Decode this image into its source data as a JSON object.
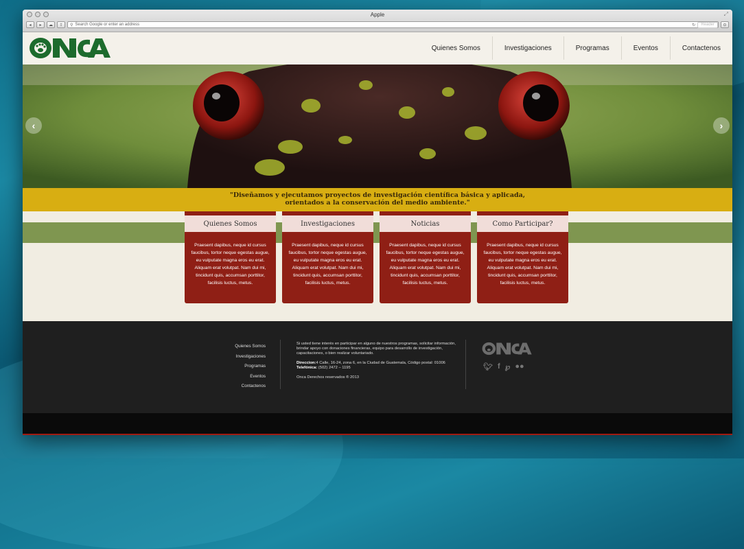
{
  "browser": {
    "title": "Apple",
    "address_placeholder": "Search Google or enter an address",
    "reader_label": "Reader"
  },
  "site": {
    "logo_text": "ONCA",
    "nav": [
      "Quienes Somos",
      "Investigaciones",
      "Programas",
      "Eventos",
      "Contactenos"
    ],
    "quote_line1": "\"Diseñamos y ejecutamos proyectos de investigación científica básica y aplicada,",
    "quote_line2": "orientados a la conservación del medio ambiente.\"",
    "cards": [
      {
        "title": "Quienes Somos",
        "text": "Praesent dapibus, neque id cursus faucibus, tortor neque egestas augue, eu vulputate magna eros eu erat. Aliquam erat volutpat. Nam dui mi, tincidunt quis, accumsan porttitor, facilisis luctus, metus."
      },
      {
        "title": "Investigaciones",
        "text": "Praesent dapibus, neque id cursus faucibus, tortor neque egestas augue, eu vulputate magna eros eu erat. Aliquam erat volutpat. Nam dui mi, tincidunt quis, accumsan porttitor, facilisis luctus, metus."
      },
      {
        "title": "Noticias",
        "text": "Praesent dapibus, neque id cursus faucibus, tortor neque egestas augue, eu vulputate magna eros eu erat. Aliquam erat volutpat. Nam dui mi, tincidunt quis, accumsan porttitor, facilisis luctus, metus."
      },
      {
        "title": "Como Participar?",
        "text": "Praesent dapibus, neque id cursus faucibus, tortor neque egestas augue, eu vulputate magna eros eu erat. Aliquam erat volutpat. Nam dui mi, tincidunt quis, accumsan porttitor, facilisis luctus, metus."
      }
    ],
    "footer": {
      "nav": [
        "Quienes Somos",
        "Investigaciones",
        "Programas",
        "Eventos",
        "Contactenos"
      ],
      "intro": "Si usted tiene interés en participar en alguno de nuestros programas, solicitar información, brindar apoyo con donaciones financieras, equipo para desarrollo de investigación, capacitaciones, o bien realizar  voluntariado.",
      "address_label": "Direccion:",
      "address": "4 Calle, 16-24, zona 6, en la Ciudad de Guatemala, Código postal: 01006",
      "phone_label": "Telefónica:",
      "phone": "(502) 2472 – 1195",
      "copyright": "Onca Derechos reservados ® 2013",
      "social": [
        "twitter-icon",
        "facebook-icon",
        "pinterest-icon",
        "flickr-icon"
      ]
    }
  },
  "colors": {
    "brand_green": "#1d6b2d",
    "card_red": "#8f1f15",
    "quote_yellow": "#d8ae12",
    "band_green": "#7f9650",
    "footer_dark": "#1f1f1f"
  }
}
